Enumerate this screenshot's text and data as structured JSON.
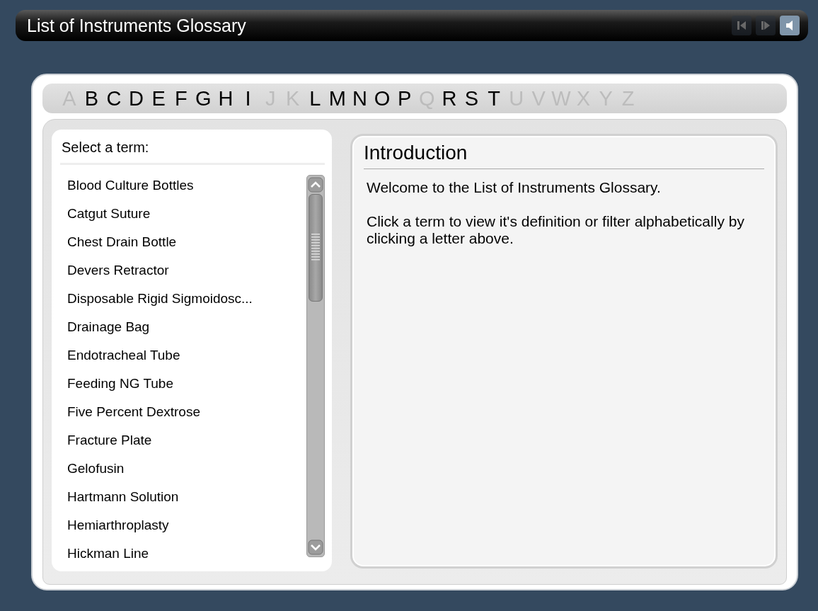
{
  "window": {
    "title": "List of Instruments Glossary",
    "controls": [
      {
        "kind": "prev",
        "disabled": true
      },
      {
        "kind": "next",
        "disabled": true
      },
      {
        "kind": "audio",
        "disabled": false
      }
    ]
  },
  "alphabet": [
    {
      "letter": "A",
      "disabled": true
    },
    {
      "letter": "B",
      "disabled": false
    },
    {
      "letter": "C",
      "disabled": false
    },
    {
      "letter": "D",
      "disabled": false
    },
    {
      "letter": "E",
      "disabled": false
    },
    {
      "letter": "F",
      "disabled": false
    },
    {
      "letter": "G",
      "disabled": false
    },
    {
      "letter": "H",
      "disabled": false
    },
    {
      "letter": "I",
      "disabled": false
    },
    {
      "letter": "J",
      "disabled": true
    },
    {
      "letter": "K",
      "disabled": true
    },
    {
      "letter": "L",
      "disabled": false
    },
    {
      "letter": "M",
      "disabled": false
    },
    {
      "letter": "N",
      "disabled": false
    },
    {
      "letter": "O",
      "disabled": false
    },
    {
      "letter": "P",
      "disabled": false
    },
    {
      "letter": "Q",
      "disabled": true
    },
    {
      "letter": "R",
      "disabled": false
    },
    {
      "letter": "S",
      "disabled": false
    },
    {
      "letter": "T",
      "disabled": false
    },
    {
      "letter": "U",
      "disabled": true
    },
    {
      "letter": "V",
      "disabled": true
    },
    {
      "letter": "W",
      "disabled": true
    },
    {
      "letter": "X",
      "disabled": true
    },
    {
      "letter": "Y",
      "disabled": true
    },
    {
      "letter": "Z",
      "disabled": true
    }
  ],
  "terms": {
    "heading": "Select a term:",
    "items": [
      "Blood Culture Bottles",
      "Catgut Suture",
      "Chest Drain Bottle",
      "Devers Retractor",
      "Disposable Rigid Sigmoidosc...",
      "Drainage Bag",
      "Endotracheal Tube",
      "Feeding NG Tube",
      "Five Percent Dextrose",
      "Fracture Plate",
      "Gelofusin",
      "Hartmann Solution",
      "Hemiarthroplasty",
      "Hickman Line"
    ]
  },
  "content": {
    "title": "Introduction",
    "paragraphs": [
      "Welcome to the List of Instruments Glossary.",
      "Click a term to view it's definition or filter alphabetically by clicking a letter above."
    ]
  }
}
